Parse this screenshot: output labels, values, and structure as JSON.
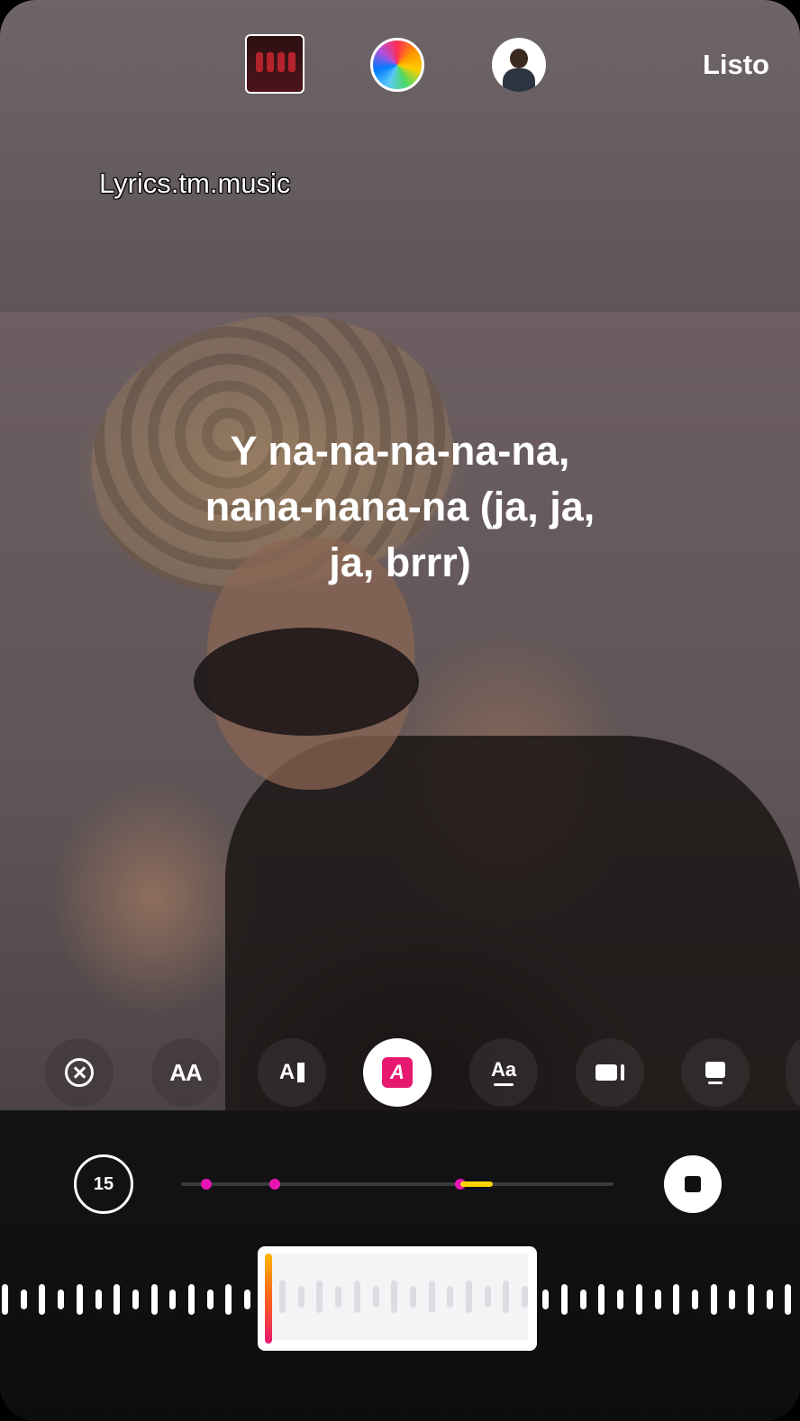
{
  "top_bar": {
    "album_cover": "album-cover",
    "color_picker": "color-wheel",
    "avatar": "avatar",
    "done_label": "Listo"
  },
  "credit_text": "Lyrics.tm.music",
  "lyrics": {
    "line1": "Y na-na-na-na-na,",
    "line2": "nana-nana-na (ja, ja,",
    "line3": "ja, brrr)"
  },
  "tools": [
    {
      "name": "close",
      "icon": "close-circle-icon"
    },
    {
      "name": "text-size",
      "label": "AA"
    },
    {
      "name": "ai-text",
      "label": "A"
    },
    {
      "name": "text-style",
      "label": "A"
    },
    {
      "name": "font",
      "label": "Aa"
    },
    {
      "name": "video",
      "icon": "video-icon"
    },
    {
      "name": "card",
      "icon": "card-icon"
    }
  ],
  "playback": {
    "skip_label": "15",
    "stop_icon": "stop-icon"
  },
  "colors": {
    "accent_pink": "#e6186f",
    "marker_magenta": "#e815b4",
    "progress_yellow": "#ffd400"
  }
}
